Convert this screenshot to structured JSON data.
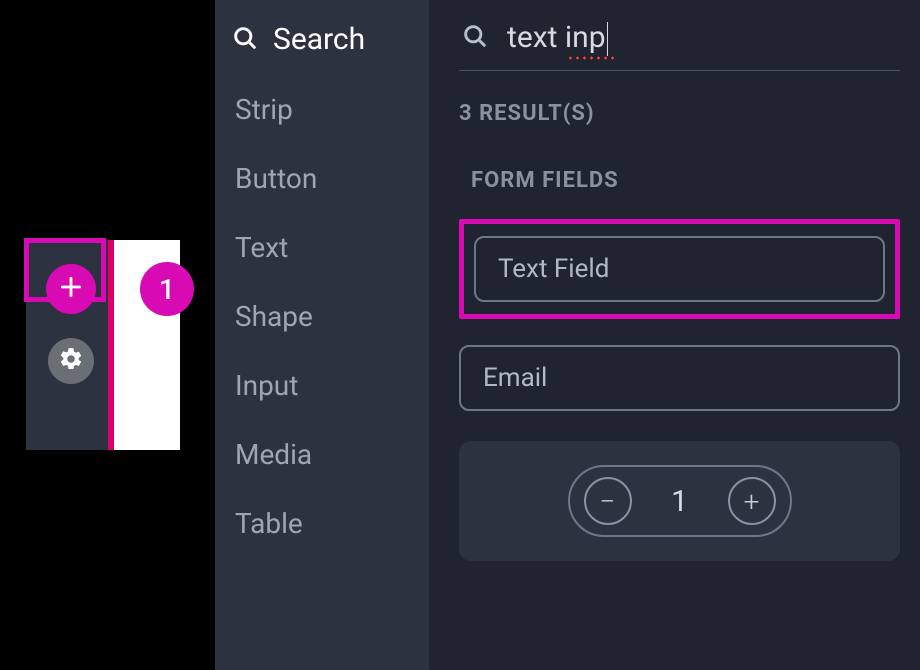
{
  "colors": {
    "accent": "#d80ab3"
  },
  "mini": {
    "badge": "1"
  },
  "categories": {
    "search_label": "Search",
    "items": [
      {
        "label": "Strip"
      },
      {
        "label": "Button"
      },
      {
        "label": "Text"
      },
      {
        "label": "Shape"
      },
      {
        "label": "Input"
      },
      {
        "label": "Media"
      },
      {
        "label": "Table"
      }
    ]
  },
  "search": {
    "value": "text inp"
  },
  "results": {
    "count_label": "3 RESULT(S)",
    "section_label": "FORM FIELDS",
    "items": [
      {
        "label": "Text Field"
      },
      {
        "label": "Email"
      }
    ],
    "spinner": {
      "value": "1",
      "minus": "−",
      "plus": "+"
    }
  }
}
